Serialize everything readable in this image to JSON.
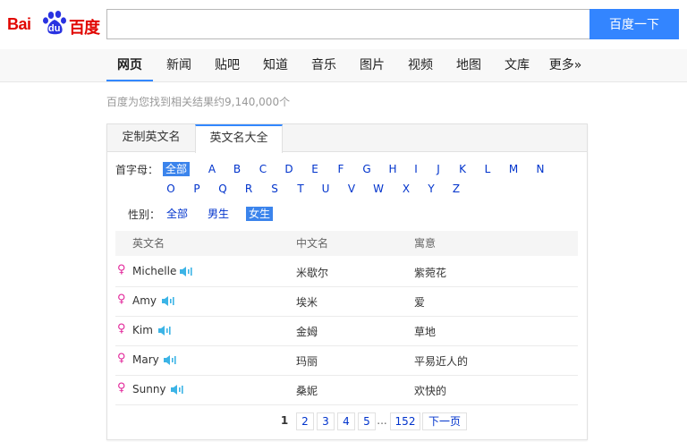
{
  "logo": {
    "latin": "Bai",
    "du": "du",
    "cn": "百度"
  },
  "search": {
    "value": "",
    "placeholder": "",
    "button": "百度一下"
  },
  "nav": [
    "网页",
    "新闻",
    "贴吧",
    "知道",
    "音乐",
    "图片",
    "视频",
    "地图",
    "文库",
    "更多»"
  ],
  "result_count": "百度为您找到相关结果约9,140,000个",
  "card": {
    "tabs": [
      "定制英文名",
      "英文名大全"
    ],
    "initial_label": "首字母：",
    "initials": [
      "全部",
      "A",
      "B",
      "C",
      "D",
      "E",
      "F",
      "G",
      "H",
      "I",
      "J",
      "K",
      "L",
      "M",
      "N",
      "O",
      "P",
      "Q",
      "R",
      "S",
      "T",
      "U",
      "V",
      "W",
      "X",
      "Y",
      "Z"
    ],
    "gender_label": "性别：",
    "genders": [
      "全部",
      "男生",
      "女生"
    ],
    "headers": [
      "英文名",
      "中文名",
      "寓意"
    ],
    "rows": [
      {
        "en": "Michelle",
        "cn": "米歇尔",
        "meaning": "紫菀花",
        "gender_icon": "♀"
      },
      {
        "en": "Amy",
        "cn": "埃米",
        "meaning": "爱",
        "gender_icon": "♀"
      },
      {
        "en": "Kim",
        "cn": "金姆",
        "meaning": "草地",
        "gender_icon": "♀"
      },
      {
        "en": "Mary",
        "cn": "玛丽",
        "meaning": "平易近人的",
        "gender_icon": "♀"
      },
      {
        "en": "Sunny",
        "cn": "桑妮",
        "meaning": "欢快的",
        "gender_icon": "♀"
      }
    ],
    "pager": [
      "1",
      "2",
      "3",
      "4",
      "5",
      "...",
      "152",
      "下一页"
    ]
  },
  "colors": {
    "brand_red": "#e10601",
    "brand_blue": "#2932e1",
    "accent": "#3385ff",
    "link": "#0033cc",
    "female": "#e2269a",
    "speaker": "#3cb4e6"
  },
  "icons": {
    "gender": "female-symbol-icon",
    "audio": "speaker-icon"
  }
}
